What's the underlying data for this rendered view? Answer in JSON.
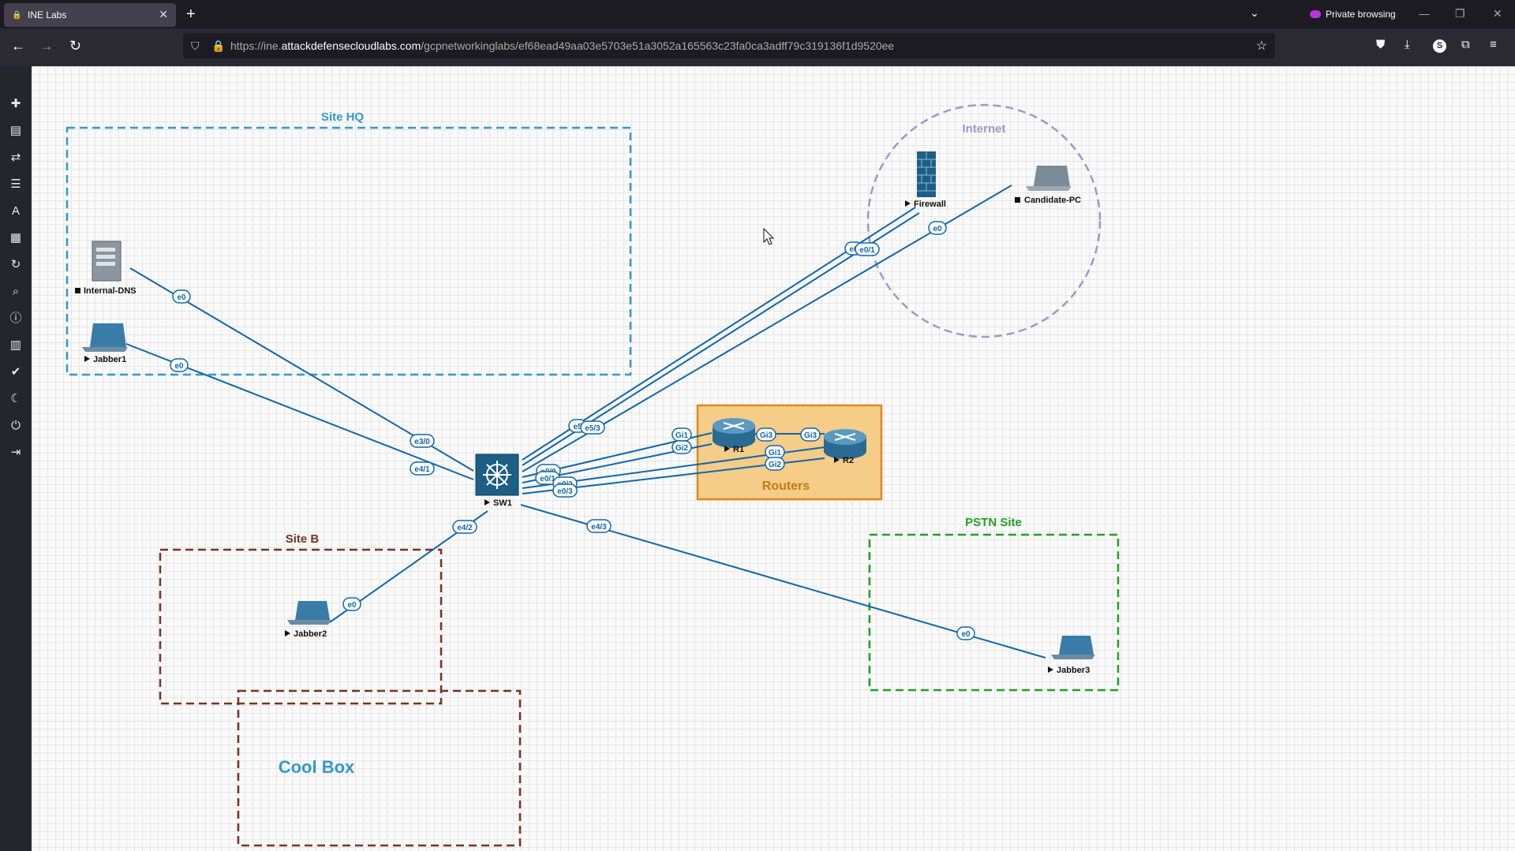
{
  "browser": {
    "tab_title": "INE Labs",
    "tab_close": "✕",
    "new_tab": "+",
    "private_label": "Private browsing",
    "url_prefix": "https://ine.",
    "url_domain": "attackdefensecloudlabs.com",
    "url_path": "/gcpnetworkinglabs/ef68ead49aa03e5703e51a3052a165563c23fa0ca3adff79c319136f1d9520ee",
    "profile_initial": "S"
  },
  "topology": {
    "zones": {
      "site_hq": "Site HQ",
      "internet": "Internet",
      "routers": "Routers",
      "site_b": "Site B",
      "pstn_site": "PSTN Site",
      "cool_box": "Cool Box"
    },
    "nodes": {
      "internal_dns": "Internal-DNS",
      "jabber1": "Jabber1",
      "jabber2": "Jabber2",
      "jabber3": "Jabber3",
      "sw1": "SW1",
      "r1": "R1",
      "r2": "R2",
      "firewall": "Firewall",
      "candidate_pc": "Candidate-PC"
    },
    "ports": {
      "dns_e0": "e0",
      "sw_e30": "e3/0",
      "j1_e0": "e0",
      "sw_e41": "e4/1",
      "sw_e42": "e4/2",
      "j2_e0": "e0",
      "sw_e43": "e4/3",
      "j3_e0": "e0",
      "sw_e5a": "e5",
      "sw_e53": "e5/3",
      "fw_e0": "e0",
      "fw_e01": "e0/1",
      "pc_e0": "e0",
      "sw_e00": "e0/0",
      "sw_e01": "e0/1",
      "sw_e02": "e0/2",
      "sw_e03": "e0/3",
      "r1_gi1": "Gi1",
      "r1_gi2": "Gi2",
      "r1_gi3": "Gi3",
      "r2_gi3": "Gi3",
      "r2_gi1": "Gi1",
      "r2_gi2": "Gi2"
    }
  },
  "colors": {
    "link": "#1166aa",
    "site_hq": "#3399cc",
    "internet": "#9a9acc",
    "site_b": "#7a3322",
    "pstn": "#22a022",
    "routers_fill": "#f5cc88",
    "routers_border": "#d98a22"
  }
}
